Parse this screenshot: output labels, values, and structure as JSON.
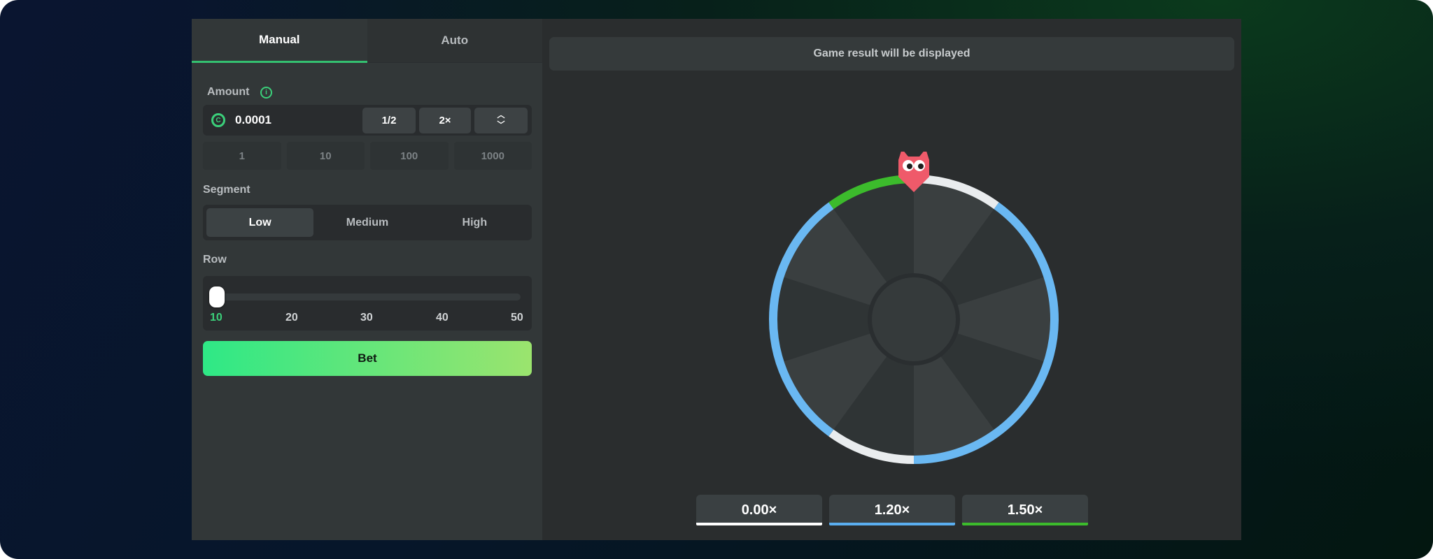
{
  "tabs": {
    "manual": "Manual",
    "auto": "Auto"
  },
  "amount": {
    "label": "Amount",
    "value": "0.0001",
    "half_label": "1/2",
    "double_label": "2×",
    "quick_values": [
      "1",
      "10",
      "100",
      "1000"
    ]
  },
  "segment": {
    "label": "Segment",
    "options": [
      "Low",
      "Medium",
      "High"
    ],
    "selected": "Low"
  },
  "row": {
    "label": "Row",
    "ticks": [
      "10",
      "20",
      "30",
      "40",
      "50"
    ],
    "value": 10
  },
  "bet_label": "Bet",
  "result_text": "Game result will be displayed",
  "multipliers": [
    {
      "value": "0.00×",
      "color": "#ffffff"
    },
    {
      "value": "1.20×",
      "color": "#5aaef0"
    },
    {
      "value": "1.50×",
      "color": "#3cbb2c"
    }
  ],
  "wheel": {
    "segments": 10,
    "ring_colors": {
      "white": "#e9ecee",
      "blue": "#6ab8f2",
      "green": "#3cbb2c"
    }
  }
}
